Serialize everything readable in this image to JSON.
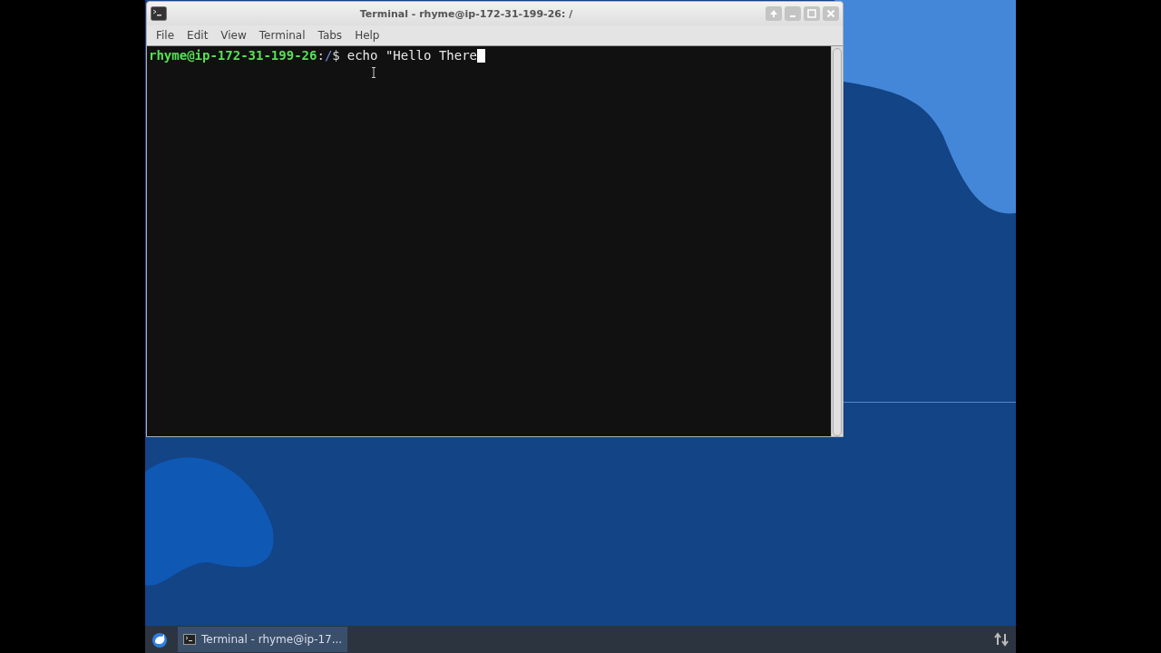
{
  "window": {
    "title": "Terminal - rhyme@ip-172-31-199-26: /",
    "active": true
  },
  "menu": [
    "File",
    "Edit",
    "View",
    "Terminal",
    "Tabs",
    "Help"
  ],
  "terminal": {
    "lines": [
      {
        "user_host": "rhyme@ip-172-31-199-26",
        "separator": ":",
        "path": "/",
        "prompt": "$",
        "command": "echo \"Hello There"
      }
    ]
  },
  "taskbar": {
    "tasks": [
      {
        "label": "Terminal - rhyme@ip-17...",
        "selected": true
      }
    ]
  }
}
